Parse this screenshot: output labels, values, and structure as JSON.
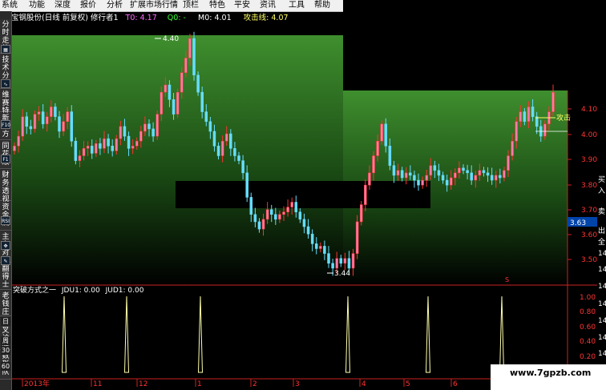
{
  "menu": [
    "系统",
    "功能",
    "深度",
    "报价",
    "分析",
    "扩展市场行情",
    "顶栏",
    "特色",
    "平安",
    "资讯",
    "工具",
    "帮助"
  ],
  "sidebar": [
    {
      "label": "分时走势"
    },
    {
      "label": "技术分析"
    },
    {
      "label": "维赛特"
    },
    {
      "label": "新东方"
    },
    {
      "label": "同花顺"
    },
    {
      "label": "财务透视"
    },
    {
      "label": "资金流"
    },
    {
      "label": "主力对比"
    },
    {
      "label": "翻得士"
    },
    {
      "label": "老钱庄"
    },
    {
      "label": "牛叉诊股"
    },
    {
      "label": "数形队"
    }
  ],
  "sidebar_icons": [
    {
      "icon": "grid-icon",
      "text": "▦"
    },
    {
      "icon": "chart-icon",
      "text": "∿"
    },
    {
      "icon": "f10-icon",
      "text": "F10"
    },
    {
      "icon": "f10-icon",
      "text": "F1"
    },
    {
      "icon": "rsi-icon",
      "text": "RSI"
    },
    {
      "icon": "arrows-icon",
      "text": "✥"
    },
    {
      "icon": "pencil-icon",
      "text": "✎"
    }
  ],
  "period_tabs": [
    "日",
    "周",
    "30",
    "60"
  ],
  "title": {
    "stock": "宝钢股份(日线 前复权) 修行者1",
    "t0": "T0: 4.17",
    "q0": "Q0: -",
    "m0": "M0: 4.01",
    "attack": "攻击线: 4.07"
  },
  "indicator": {
    "name": "突破方式之一",
    "jdu": "JDU1: 0.00",
    "jud": "JUD1: 0.00"
  },
  "price_axis": [
    "4.10",
    "4.00",
    "3.90",
    "3.80",
    "3.70",
    "3.60",
    "3.50"
  ],
  "indicator_axis": [
    "1.00",
    "0.80",
    "0.60",
    "0.40",
    "0.20"
  ],
  "current_price": "3.63",
  "annotations": {
    "high": "4.40",
    "low": "3.44",
    "attack_label": "攻击",
    "s_mark": "S"
  },
  "date_axis": [
    "2013年",
    "11",
    "12",
    "1",
    "2",
    "3",
    "4",
    "5",
    "6"
  ],
  "right_panel": [
    "买",
    "入",
    "卖",
    "出",
    "全",
    "14",
    "14",
    "14",
    "14",
    "14",
    "14",
    "14",
    "14"
  ],
  "watermark": "www.7gpzb.com",
  "colors": {
    "up": "#ff3333",
    "up_fill": "#ff7aa8",
    "down": "#66ddff",
    "attack_line": "#ffff66",
    "axis": "#cc2222",
    "green_top": "#3f8f2e",
    "green_bottom": "#000000"
  },
  "chart_data": {
    "type": "candlestick",
    "y_axis_range": [
      3.44,
      4.17
    ],
    "annotated_high": 4.4,
    "annotated_low": 3.44,
    "attack_line": 4.07,
    "indicator_series": {
      "name": "JDU1",
      "spike_value": 1.0,
      "baseline": 0.0,
      "spike_count": 6
    },
    "closes": [
      3.96,
      4.0,
      4.08,
      4.04,
      4.03,
      4.09,
      4.1,
      4.05,
      4.08,
      4.12,
      4.08,
      4.02,
      4.06,
      4.1,
      3.98,
      3.9,
      3.92,
      3.95,
      3.96,
      3.93,
      3.97,
      3.95,
      3.99,
      3.96,
      3.94,
      3.99,
      4.04,
      4.0,
      3.95,
      3.96,
      3.98,
      4.02,
      4.05,
      4.03,
      4.0,
      4.09,
      4.18,
      4.21,
      4.15,
      4.09,
      4.18,
      4.26,
      4.32,
      4.4,
      4.25,
      4.18,
      4.1,
      4.06,
      4.02,
      3.96,
      3.92,
      3.98,
      4.01,
      3.95,
      3.92,
      3.9,
      3.85,
      3.75,
      3.68,
      3.65,
      3.62,
      3.66,
      3.7,
      3.68,
      3.66,
      3.68,
      3.69,
      3.71,
      3.73,
      3.69,
      3.66,
      3.63,
      3.6,
      3.56,
      3.54,
      3.55,
      3.52,
      3.48,
      3.46,
      3.5,
      3.48,
      3.5,
      3.46,
      3.52,
      3.65,
      3.72,
      3.8,
      3.85,
      3.92,
      3.98,
      4.05,
      3.96,
      3.88,
      3.84,
      3.86,
      3.83,
      3.85,
      3.84,
      3.82,
      3.8,
      3.82,
      3.84,
      3.88,
      3.86,
      3.84,
      3.82,
      3.8,
      3.83,
      3.85,
      3.87,
      3.86,
      3.85,
      3.82,
      3.84,
      3.86,
      3.85,
      3.84,
      3.82,
      3.84,
      3.83,
      3.86,
      3.92,
      3.98,
      4.06,
      4.1,
      4.06,
      4.12,
      4.08,
      4.04,
      4.0,
      4.05,
      4.1,
      4.18
    ]
  }
}
